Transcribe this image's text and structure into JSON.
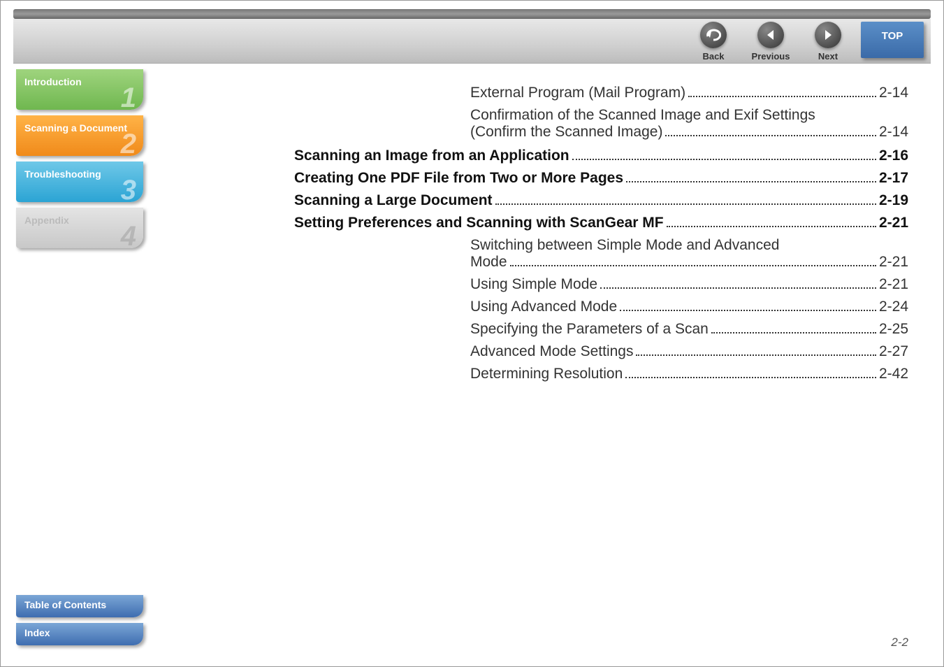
{
  "nav": {
    "back": "Back",
    "previous": "Previous",
    "next": "Next",
    "top": "TOP"
  },
  "sidebar": {
    "tab1": {
      "label": "Introduction",
      "num": "1"
    },
    "tab2": {
      "label": "Scanning a Document",
      "num": "2"
    },
    "tab3": {
      "label": "Troubleshooting",
      "num": "3"
    },
    "tab4": {
      "label": "Appendix",
      "num": "4"
    }
  },
  "bottomTabs": {
    "toc": "Table of Contents",
    "index": "Index"
  },
  "toc": {
    "r1": {
      "title": "External Program (Mail Program)",
      "page": "2-14"
    },
    "r2a": {
      "title": "Confirmation of the Scanned Image and Exif Settings"
    },
    "r2b": {
      "title": "(Confirm the Scanned Image)",
      "page": "2-14"
    },
    "r3": {
      "title": "Scanning an Image from an Application",
      "page": "2-16"
    },
    "r4": {
      "title": "Creating One PDF File from Two or More Pages",
      "page": "2-17"
    },
    "r5": {
      "title": "Scanning a Large Document",
      "page": "2-19"
    },
    "r6": {
      "title": "Setting Preferences and Scanning with ScanGear MF",
      "page": "2-21"
    },
    "r7a": {
      "title": "Switching between Simple Mode and Advanced"
    },
    "r7b": {
      "title": "Mode",
      "page": "2-21"
    },
    "r8": {
      "title": "Using Simple Mode",
      "page": "2-21"
    },
    "r9": {
      "title": "Using Advanced Mode",
      "page": "2-24"
    },
    "r10": {
      "title": "Specifying the Parameters of a Scan",
      "page": "2-25"
    },
    "r11": {
      "title": "Advanced Mode Settings",
      "page": "2-27"
    },
    "r12": {
      "title": "Determining Resolution",
      "page": "2-42"
    }
  },
  "footer": {
    "pageNumber": "2-2"
  }
}
